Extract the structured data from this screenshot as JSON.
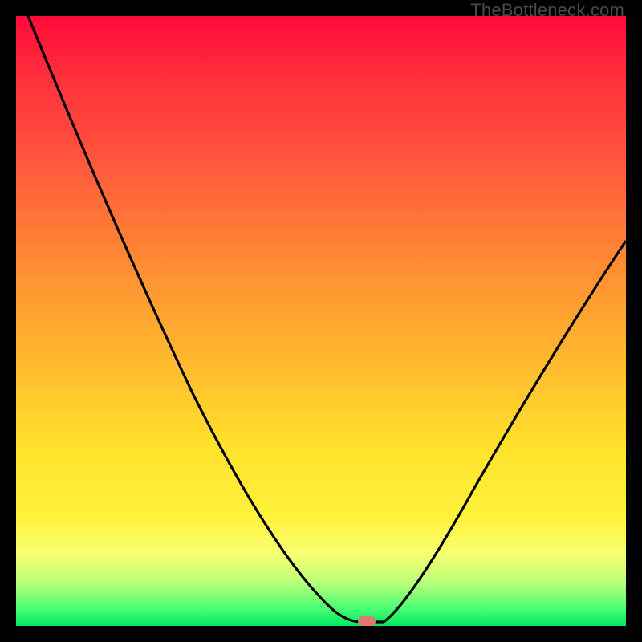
{
  "watermark": "TheBottleneck.com",
  "colors": {
    "frame": "#000000",
    "curve": "#000000",
    "marker": "#e07a6f"
  },
  "chart_data": {
    "type": "line",
    "title": "",
    "xlabel": "",
    "ylabel": "",
    "xlim": [
      0,
      100
    ],
    "ylim": [
      0,
      100
    ],
    "x": [
      0,
      5,
      10,
      15,
      20,
      25,
      30,
      35,
      40,
      45,
      50,
      52,
      54,
      56,
      58,
      60,
      65,
      70,
      75,
      80,
      85,
      90,
      95,
      100
    ],
    "values": [
      100,
      91,
      82,
      73,
      64,
      56,
      48,
      40,
      32,
      24,
      15,
      9,
      4,
      1,
      0,
      0,
      6,
      14,
      22,
      31,
      40,
      49,
      57,
      63
    ],
    "minimum_x": 58,
    "note": "Vertical axis encodes bottleneck percentage (high=red=bad, low=green=good). Values are read off the gradient; curve dips to ~0% near x≈58 and rises on either side."
  },
  "marker": {
    "x_pct": 57.5,
    "y_pct": 99.2
  }
}
